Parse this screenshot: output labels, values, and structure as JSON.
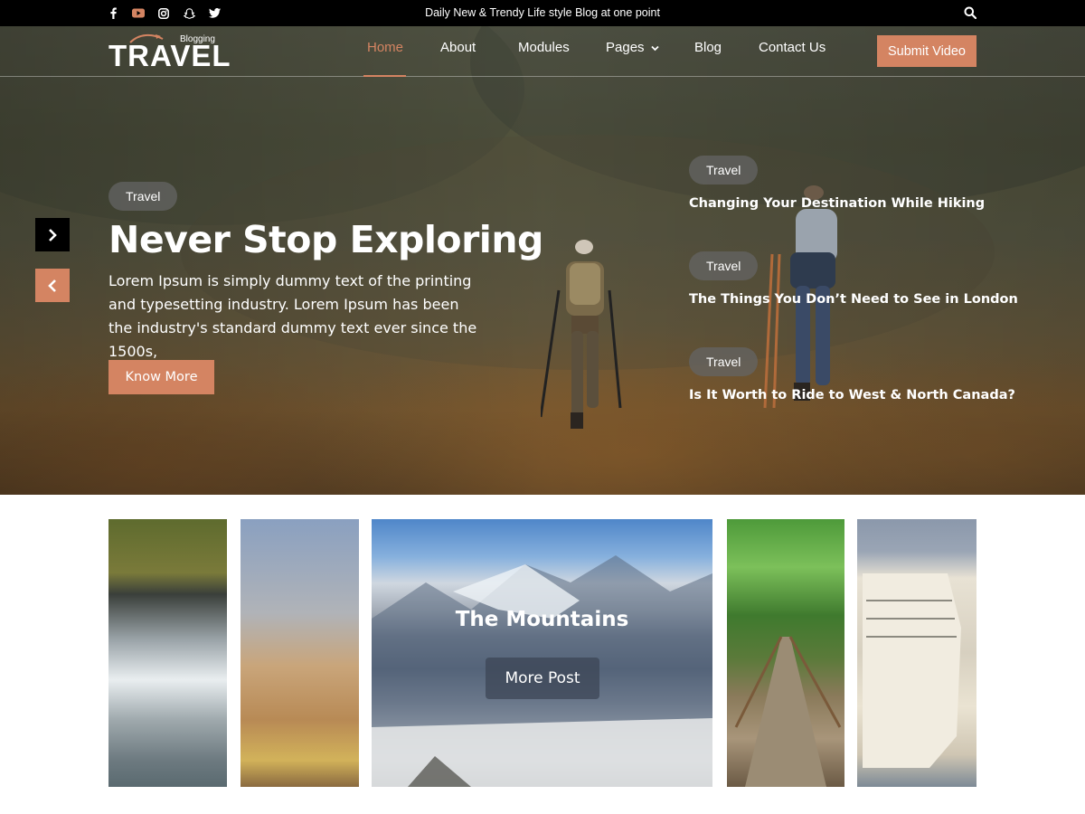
{
  "topbar": {
    "social_icons": [
      "facebook-icon",
      "youtube-icon",
      "instagram-icon",
      "snapchat-icon",
      "twitter-icon"
    ],
    "tagline": "Daily New & Trendy Life style Blog at one point",
    "search_icon": "search-icon"
  },
  "header": {
    "logo": {
      "main": "TRAVEL",
      "small": "Blogging"
    },
    "nav": [
      {
        "label": "Home",
        "active": true
      },
      {
        "label": "About"
      },
      {
        "label": "Modules"
      },
      {
        "label": "Pages",
        "has_dropdown": true
      },
      {
        "label": "Blog"
      },
      {
        "label": "Contact Us"
      }
    ],
    "cta_label": "Submit Video"
  },
  "hero": {
    "category": "Travel",
    "title": "Never Stop Exploring",
    "description": "Lorem Ipsum is simply dummy text of the printing and typesetting industry. Lorem Ipsum has been the industry's standard dummy text ever since the 1500s,",
    "button_label": "Know More",
    "side_posts": [
      {
        "category": "Travel",
        "title": "Changing Your Destination While Hiking"
      },
      {
        "category": "Travel",
        "title": "The Things You Don’t Need to See in London"
      },
      {
        "category": "Travel",
        "title": "Is It Worth to Ride to West & North Canada?"
      }
    ]
  },
  "gallery": {
    "tiles": [
      "waterfall",
      "city-buildings",
      "mountains",
      "forest-bridge",
      "cruise-ship"
    ],
    "featured_title": "The Mountains",
    "featured_button": "More Post"
  },
  "colors": {
    "accent": "#d48462",
    "topbar": "#000000"
  }
}
